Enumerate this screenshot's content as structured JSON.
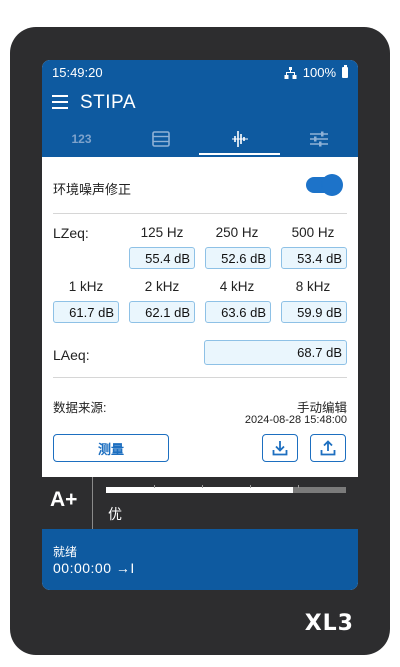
{
  "device": {
    "model": "XL3"
  },
  "status_bar": {
    "time": "15:49:20",
    "battery": "100%"
  },
  "app_bar": {
    "title": "STIPA"
  },
  "tabs": [
    {
      "label": "123",
      "icon": "numeric-tab-icon"
    },
    {
      "icon": "table-list-icon"
    },
    {
      "icon": "waveform-icon",
      "active": true
    },
    {
      "icon": "sliders-icon"
    }
  ],
  "noise_correction": {
    "label": "环境噪声修正",
    "enabled": true
  },
  "lzeq": {
    "label": "LZeq:",
    "bands": [
      {
        "freq": "125 Hz",
        "value": "55.4 dB"
      },
      {
        "freq": "250 Hz",
        "value": "52.6 dB"
      },
      {
        "freq": "500 Hz",
        "value": "53.4 dB"
      },
      {
        "freq": "1 kHz",
        "value": "61.7 dB"
      },
      {
        "freq": "2 kHz",
        "value": "62.1 dB"
      },
      {
        "freq": "4 kHz",
        "value": "63.6 dB"
      },
      {
        "freq": "8 kHz",
        "value": "59.9 dB"
      }
    ]
  },
  "laeq": {
    "label": "LAeq:",
    "value": "68.7 dB"
  },
  "data_source": {
    "label": "数据来源:",
    "value": "手动编辑",
    "timestamp": "2024-08-28 15:48:00"
  },
  "actions": {
    "measure_label": "测量"
  },
  "rating": {
    "grade": "A+",
    "word": "优",
    "level_fraction": 0.78
  },
  "footer": {
    "state": "就绪",
    "timer": "00:00:00 →I"
  },
  "colors": {
    "primary": "#0e5aa0",
    "accent": "#1d6fc0",
    "field_bg": "#eaf6fd",
    "device": "#2d2d2f"
  }
}
